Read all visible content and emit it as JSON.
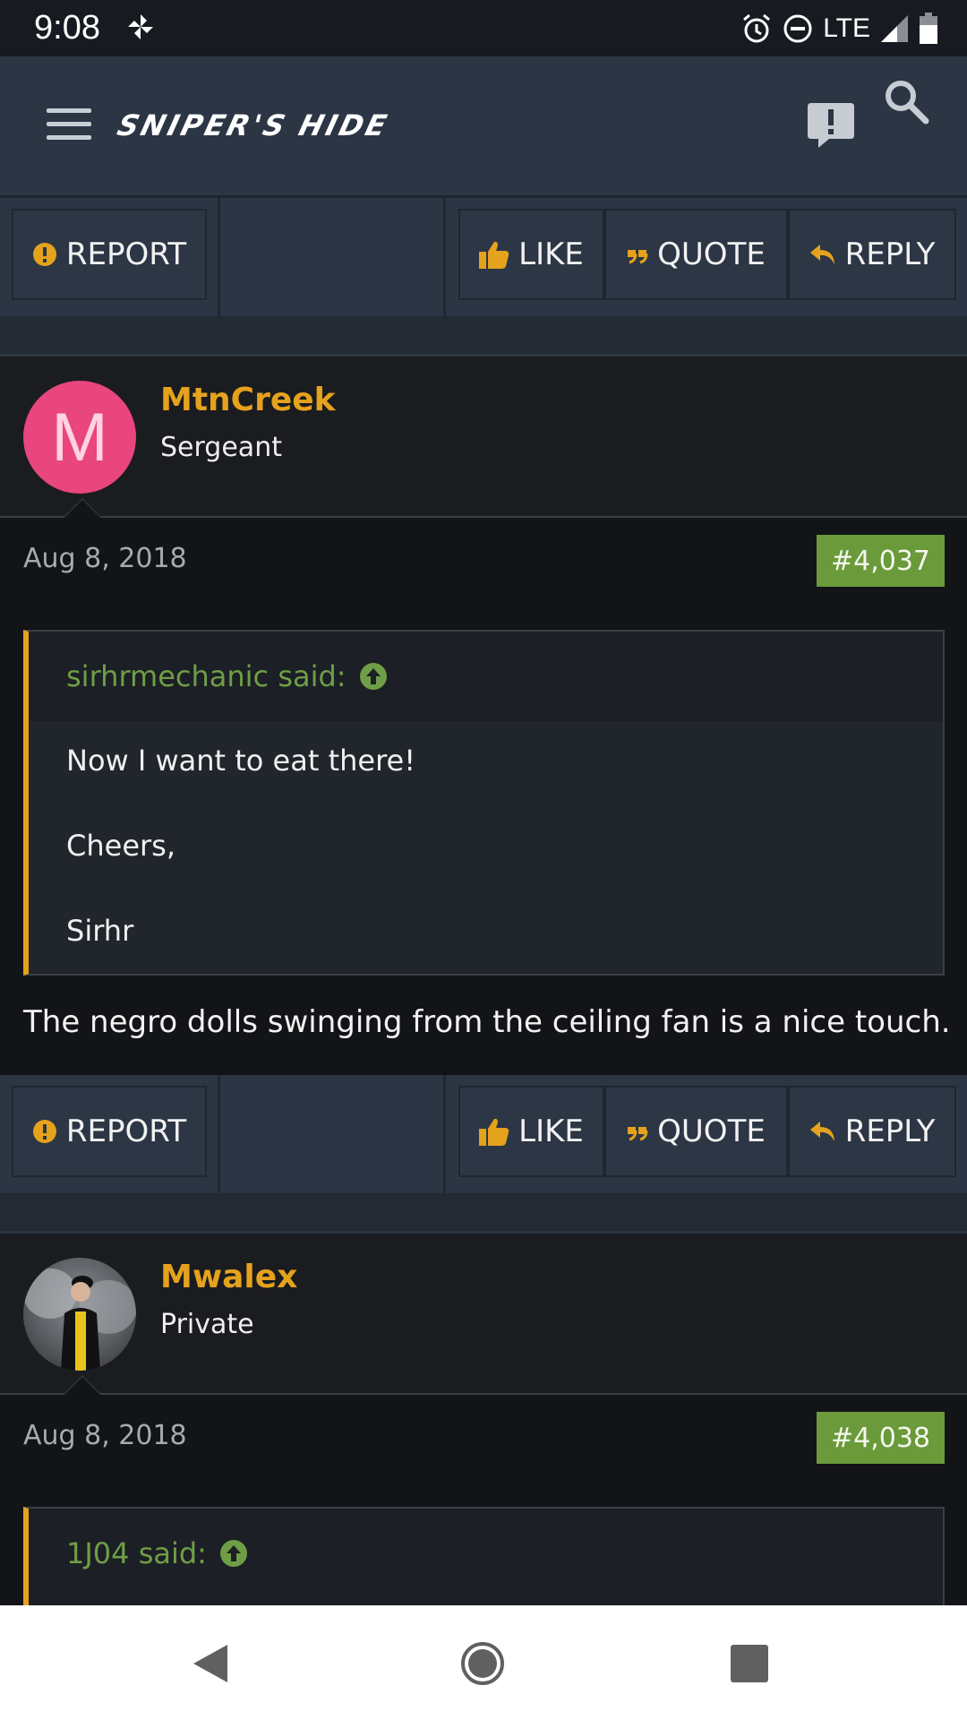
{
  "status_bar": {
    "time": "9:08",
    "network": "LTE",
    "icons": [
      "pinwheel-icon",
      "alarm-icon",
      "dnd-icon",
      "signal-icon",
      "battery-icon"
    ]
  },
  "header": {
    "logo_text": "SNIPER'S HIDE",
    "icons": [
      "menu-icon",
      "alert-icon",
      "search-icon"
    ]
  },
  "actions": {
    "report": "REPORT",
    "like": "LIKE",
    "quote": "QUOTE",
    "reply": "REPLY"
  },
  "posts": [
    {
      "username": "MtnCreek",
      "user_title": "Sergeant",
      "avatar_letter": "M",
      "date": "Aug 8, 2018",
      "post_number": "#4,037",
      "quote": {
        "author_line": "sirhrmechanic said:",
        "lines": [
          "Now I want to eat there!",
          "Cheers,",
          "Sirhr"
        ]
      },
      "text": "The negro dolls swinging from the ceiling fan is a nice touch."
    },
    {
      "username": "Mwalex",
      "user_title": "Private",
      "date": "Aug 8, 2018",
      "post_number": "#4,038",
      "quote": {
        "author_line": "1J04 said:"
      }
    }
  ],
  "colors": {
    "accent": "#e5a21c",
    "post_number_bg": "#6a9a3a",
    "quote_author": "#6f9e46",
    "header_bg": "#2b3544",
    "avatar_bg": "#e8467c"
  }
}
